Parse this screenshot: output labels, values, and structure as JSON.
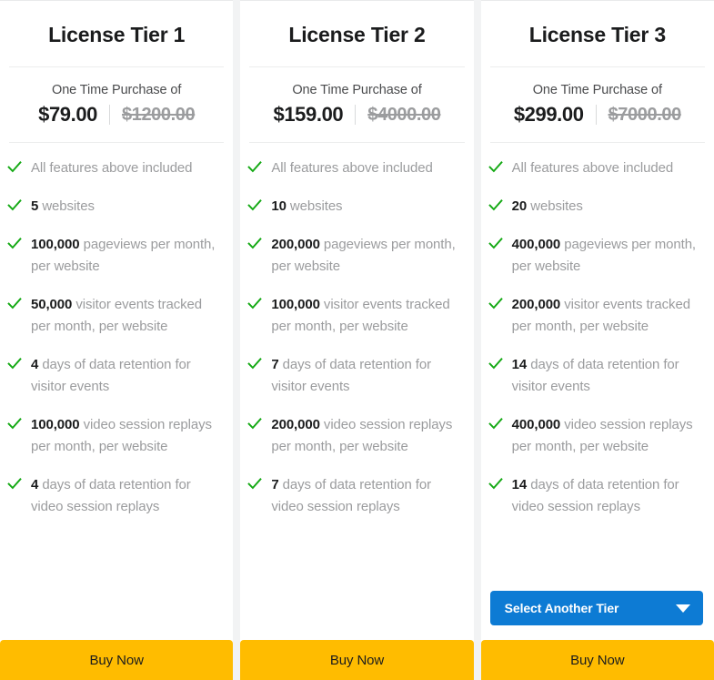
{
  "theme": {
    "page_background": "#f2f3f4",
    "card_background": "#ffffff",
    "check_color": "#14a914",
    "accent_blue": "#0d7bd4",
    "buy_yellow": "#ffbc00",
    "heading_color": "#1b1c1d",
    "muted_text": "#9b9c9e"
  },
  "price_lead_label": "One Time Purchase of",
  "buy_label": "Buy Now",
  "select_tier_label": "Select Another Tier",
  "icons": {
    "check": "check-icon",
    "caret": "chevron-down-icon"
  },
  "tiers": [
    {
      "title": "License Tier 1",
      "price_lead": "One Time Purchase of",
      "price_now": "$79.00",
      "price_was": "$1200.00",
      "features": [
        {
          "strong": "",
          "text": "All features above included"
        },
        {
          "strong": "5",
          "text": " websites"
        },
        {
          "strong": "100,000",
          "text": " pageviews per month, per website"
        },
        {
          "strong": "50,000",
          "text": " visitor events tracked per month, per website"
        },
        {
          "strong": "4",
          "text": " days of data retention for visitor events"
        },
        {
          "strong": "100,000",
          "text": " video session replays per month, per website"
        },
        {
          "strong": "4",
          "text": " days of data retention for video session replays"
        }
      ],
      "has_tier_select": false,
      "buy_label": "Buy Now"
    },
    {
      "title": "License Tier 2",
      "price_lead": "One Time Purchase of",
      "price_now": "$159.00",
      "price_was": "$4000.00",
      "features": [
        {
          "strong": "",
          "text": "All features above included"
        },
        {
          "strong": "10",
          "text": " websites"
        },
        {
          "strong": "200,000",
          "text": " pageviews per month, per website"
        },
        {
          "strong": "100,000",
          "text": " visitor events tracked per month, per website"
        },
        {
          "strong": "7",
          "text": " days of data retention for visitor events"
        },
        {
          "strong": "200,000",
          "text": " video session replays per month, per website"
        },
        {
          "strong": "7",
          "text": " days of data retention for video session replays"
        }
      ],
      "has_tier_select": false,
      "buy_label": "Buy Now"
    },
    {
      "title": "License Tier 3",
      "price_lead": "One Time Purchase of",
      "price_now": "$299.00",
      "price_was": "$7000.00",
      "features": [
        {
          "strong": "",
          "text": "All features above included"
        },
        {
          "strong": "20",
          "text": " websites"
        },
        {
          "strong": "400,000",
          "text": " pageviews per month, per website"
        },
        {
          "strong": "200,000",
          "text": " visitor events tracked per month, per website"
        },
        {
          "strong": "14",
          "text": " days of data retention for visitor events"
        },
        {
          "strong": "400,000",
          "text": " video session replays per month, per website"
        },
        {
          "strong": "14",
          "text": " days of data retention for video session replays"
        }
      ],
      "has_tier_select": true,
      "select_tier_label": "Select Another Tier",
      "buy_label": "Buy Now"
    }
  ]
}
